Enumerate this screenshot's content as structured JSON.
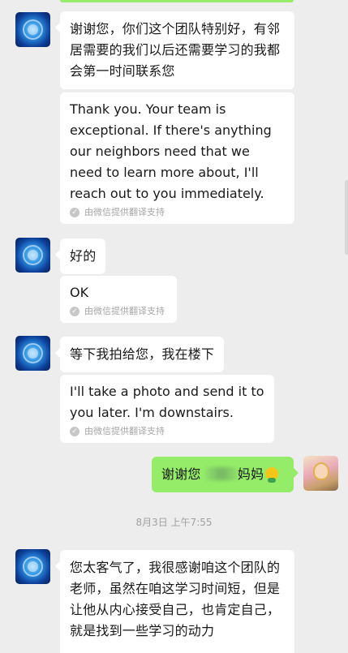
{
  "messages": {
    "m1": {
      "text": "谢谢您，你们这个团队特别好，有邻居需要的我们以后还需要学习的我都会第一时间联系您"
    },
    "t1": {
      "text": "Thank you. Your team is exceptional. If there's anything our neighbors need that we need to learn more about, I'll reach out to you immediately."
    },
    "m2": {
      "text": "好的"
    },
    "t2": {
      "text": "OK"
    },
    "m3": {
      "text": "等下我拍给您，我在楼下"
    },
    "t3": {
      "text": "I'll take a photo and send it to you later. I'm downstairs."
    },
    "me1": {
      "text_a": "谢谢您",
      "text_b": "妈妈"
    },
    "m4": {
      "text": "您太客气了，我很感谢咱这个团队的老师，虽然在咱这学习时间短，但是让他从内心接受自己，也肯定自己，就是找到一些学习的动力"
    }
  },
  "translation_credit": "由微信提供翻译支持",
  "timestamp": "8月3日 上午7:55",
  "colors": {
    "background": "#ededed",
    "own_bubble": "#95ec69",
    "other_bubble": "#ffffff"
  },
  "icons": {
    "credit": "check-circle-icon",
    "emoji": "emoji-icon"
  }
}
